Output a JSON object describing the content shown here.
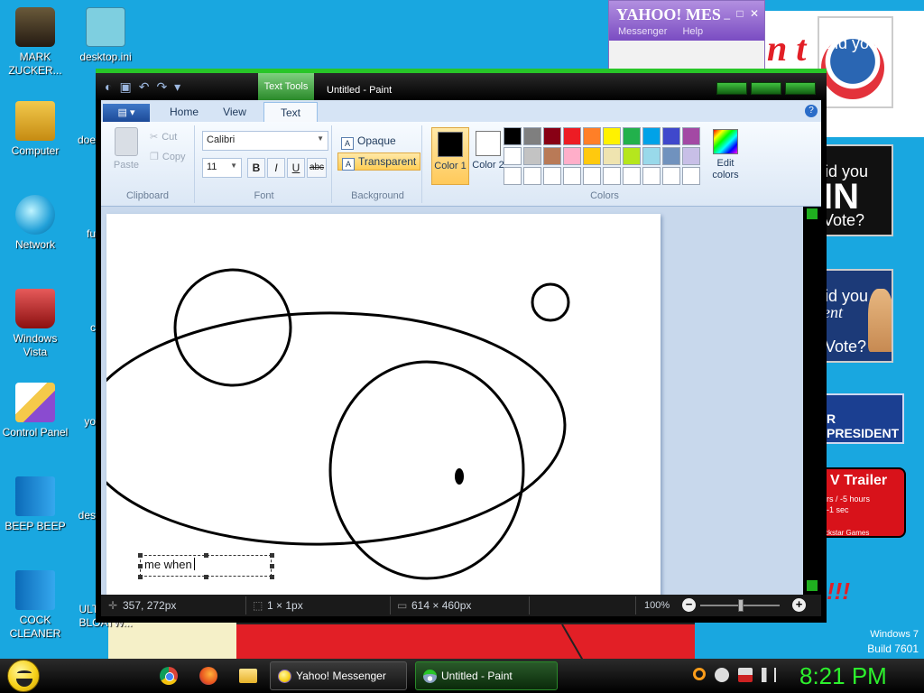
{
  "desktop": {
    "icons_left": [
      {
        "label": "MARK ZUCKER...",
        "icon": "person-icon"
      },
      {
        "label": "Computer",
        "icon": "computer-icon"
      },
      {
        "label": "Network",
        "icon": "network-icon"
      },
      {
        "label": "Windows Vista",
        "icon": "recycle-bin-icon"
      },
      {
        "label": "Control Panel",
        "icon": "control-panel-icon"
      },
      {
        "label": "BEEP BEEP",
        "icon": "book-icon"
      },
      {
        "label": "COCK CLEANER",
        "icon": "book-icon"
      }
    ],
    "icons_second": [
      {
        "label": "desktop.ini",
        "icon": "ini-file-icon"
      },
      {
        "label": "doe",
        "icon": "app-icon"
      },
      {
        "label": "fu",
        "icon": "app-icon"
      },
      {
        "label": "c",
        "icon": "app-icon"
      },
      {
        "label": "yo",
        "icon": "app-icon"
      },
      {
        "label": "des",
        "icon": "app-icon"
      },
      {
        "label": "ULTRA GD BLOATW...",
        "icon": "app-icon"
      }
    ],
    "wallpaper": {
      "fragment_text": "n t",
      "exclaim": "!!!",
      "posters": {
        "obama": "Did you",
        "mccain": [
          "id you",
          "IN",
          "Vote?"
        ],
        "hillary": [
          "id you",
          "ent",
          "Vote?"
        ],
        "president": "R PRESIDENT",
        "gta": [
          "V Trailer",
          "rs / -5 hours",
          "-1 sec",
          "ckstar Games"
        ]
      }
    },
    "watermark": {
      "os": "Windows 7",
      "build": "Build 7601"
    }
  },
  "yahoo": {
    "title": "YAHOO! MES",
    "menu": [
      "Messenger",
      "Help"
    ],
    "buttons": [
      "_",
      "□",
      "✕"
    ]
  },
  "paint": {
    "title": "Untitled - Paint",
    "context_tab": "Text Tools",
    "tabs": [
      "Home",
      "View",
      "Text"
    ],
    "active_tab": "Text",
    "groups": {
      "clipboard": {
        "label": "Clipboard",
        "paste": "Paste",
        "cut": "Cut",
        "copy": "Copy"
      },
      "font": {
        "label": "Font",
        "family": "Calibri",
        "size": "11",
        "bold": "B",
        "italic": "I",
        "underline": "U",
        "strike": "abc"
      },
      "background": {
        "label": "Background",
        "opaque": "Opaque",
        "transparent": "Transparent"
      },
      "colors": {
        "label": "Colors",
        "color1": "Color 1",
        "color2": "Color 2",
        "edit": "Edit colors"
      }
    },
    "palette": [
      "#000000",
      "#7f7f7f",
      "#880015",
      "#ed1c24",
      "#ff7f27",
      "#fff200",
      "#22b14c",
      "#00a2e8",
      "#3f48cc",
      "#a349a4",
      "#ffffff",
      "#c3c3c3",
      "#b97a57",
      "#ffaec9",
      "#ffc90e",
      "#efe4b0",
      "#b5e61d",
      "#99d9ea",
      "#7092be",
      "#c8bfe7",
      "#ffffff",
      "#ffffff",
      "#ffffff",
      "#ffffff",
      "#ffffff",
      "#ffffff",
      "#ffffff",
      "#ffffff",
      "#ffffff",
      "#ffffff"
    ],
    "color1": "#000000",
    "color2": "#ffffff",
    "text_box": "me when",
    "status": {
      "cursor": "357, 272px",
      "selection": "1 × 1px",
      "size": "614 × 460px",
      "zoom": "100%"
    }
  },
  "taskbar": {
    "tasks": [
      {
        "label": "Yahoo! Messenger"
      },
      {
        "label": "Untitled - Paint"
      }
    ],
    "clock": "8:21 PM"
  },
  "colors": {
    "accent_green": "#28c628",
    "desktop_blue": "#19a7e0"
  }
}
